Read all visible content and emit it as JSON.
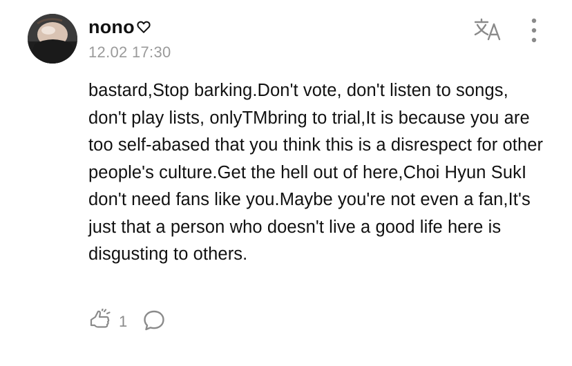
{
  "post": {
    "author": {
      "name": "nono",
      "badge_icon": "heart-outline-icon"
    },
    "timestamp": "12.02 17:30",
    "body": "bastard,Stop barking.Don't vote, don't listen to songs, don't play lists, onlyTMbring to trial,It is because you are too self-abased that you think this is a disrespect for other people's culture.Get the hell out of here,Choi Hyun SukI don't need fans like you.Maybe you're not even a fan,It's just that a person who doesn't live a good life here is disgusting to others.",
    "header_actions": {
      "translate_icon": "translate-icon",
      "more_icon": "more-vertical-icon"
    },
    "footer": {
      "like_icon": "like-hand-icon",
      "like_count": "1",
      "comment_icon": "comment-bubble-icon"
    }
  },
  "colors": {
    "text": "#111111",
    "muted": "#9a9a9a",
    "icon": "#8a8a8a"
  }
}
